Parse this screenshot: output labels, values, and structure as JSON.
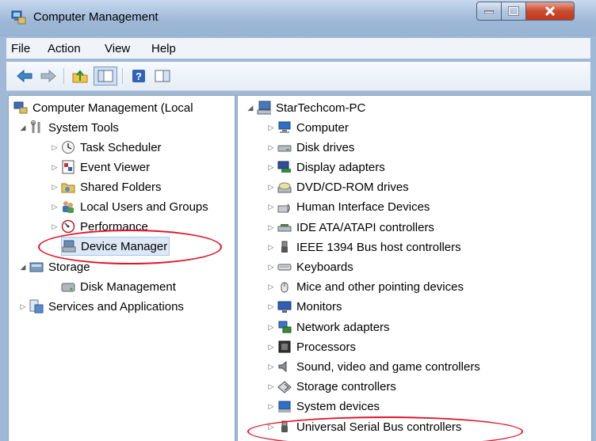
{
  "window": {
    "title": "Computer Management"
  },
  "menu": [
    "File",
    "Action",
    "View",
    "Help"
  ],
  "left_tree": [
    {
      "label": "Computer Management (Local",
      "icon": "computer-management-icon"
    },
    {
      "label": "System Tools",
      "icon": "tools-icon"
    },
    {
      "label": "Task Scheduler",
      "icon": "clock-icon"
    },
    {
      "label": "Event Viewer",
      "icon": "event-viewer-icon"
    },
    {
      "label": "Shared Folders",
      "icon": "shared-folders-icon"
    },
    {
      "label": "Local Users and Groups",
      "icon": "users-icon"
    },
    {
      "label": "Performance",
      "icon": "performance-icon"
    },
    {
      "label": "Device Manager",
      "icon": "device-manager-icon"
    },
    {
      "label": "Storage",
      "icon": "storage-icon"
    },
    {
      "label": "Disk Management",
      "icon": "disk-management-icon"
    },
    {
      "label": "Services and Applications",
      "icon": "services-icon"
    }
  ],
  "right_tree": {
    "root": "StarTechcom-PC",
    "items": [
      "Computer",
      "Disk drives",
      "Display adapters",
      "DVD/CD-ROM drives",
      "Human Interface Devices",
      "IDE ATA/ATAPI controllers",
      "IEEE 1394 Bus host controllers",
      "Keyboards",
      "Mice and other pointing devices",
      "Monitors",
      "Network adapters",
      "Processors",
      "Sound, video and game controllers",
      "Storage controllers",
      "System devices",
      "Universal Serial Bus controllers"
    ]
  },
  "colors": {
    "annotation": "#e0152a",
    "titlebar": "#9db7d6",
    "selection": "#dde8f6"
  }
}
